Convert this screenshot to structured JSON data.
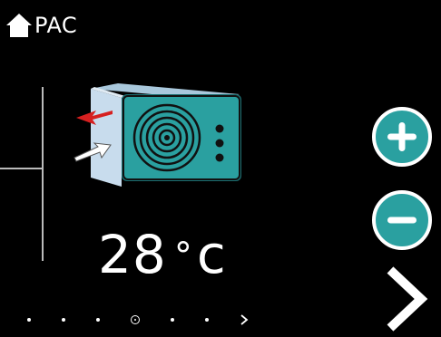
{
  "header": {
    "title": "PAC",
    "icon": "home-icon"
  },
  "device": {
    "icon": "heat-pump-unit-icon",
    "accent": "#2aa0a0",
    "arrow_out_color": "#d62020",
    "arrow_in_color": "#ffffff"
  },
  "temperature": {
    "value": "28",
    "degree": "°",
    "unit": "c"
  },
  "controls": {
    "increase_icon": "plus-icon",
    "decrease_icon": "minus-icon",
    "next_icon": "chevron-right-icon",
    "button_color": "#2aa0a0"
  },
  "pager": {
    "total_pages": 7,
    "current_page": 4
  }
}
